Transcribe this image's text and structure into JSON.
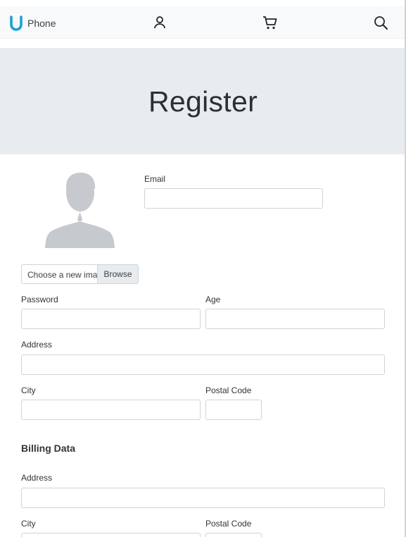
{
  "navbar": {
    "brand_text": "Phone",
    "icons": [
      "brand-logo-icon",
      "user-icon",
      "cart-icon",
      "search-icon"
    ]
  },
  "hero": {
    "title": "Register"
  },
  "form": {
    "email_label": "Email",
    "file_placeholder": "Choose a new image",
    "file_button": "Browse",
    "password_label": "Password",
    "age_label": "Age",
    "address_label": "Address",
    "city_label": "City",
    "postal_code_label": "Postal Code"
  },
  "billing": {
    "title": "Billing Data",
    "address_label": "Address",
    "city_label": "City",
    "postal_code_label": "Postal Code"
  },
  "colors": {
    "brand": "#1ba1d6",
    "hero_bg": "#e9ecef",
    "navbar_bg": "#f8f9fa",
    "avatar": "#c6c9ce"
  }
}
